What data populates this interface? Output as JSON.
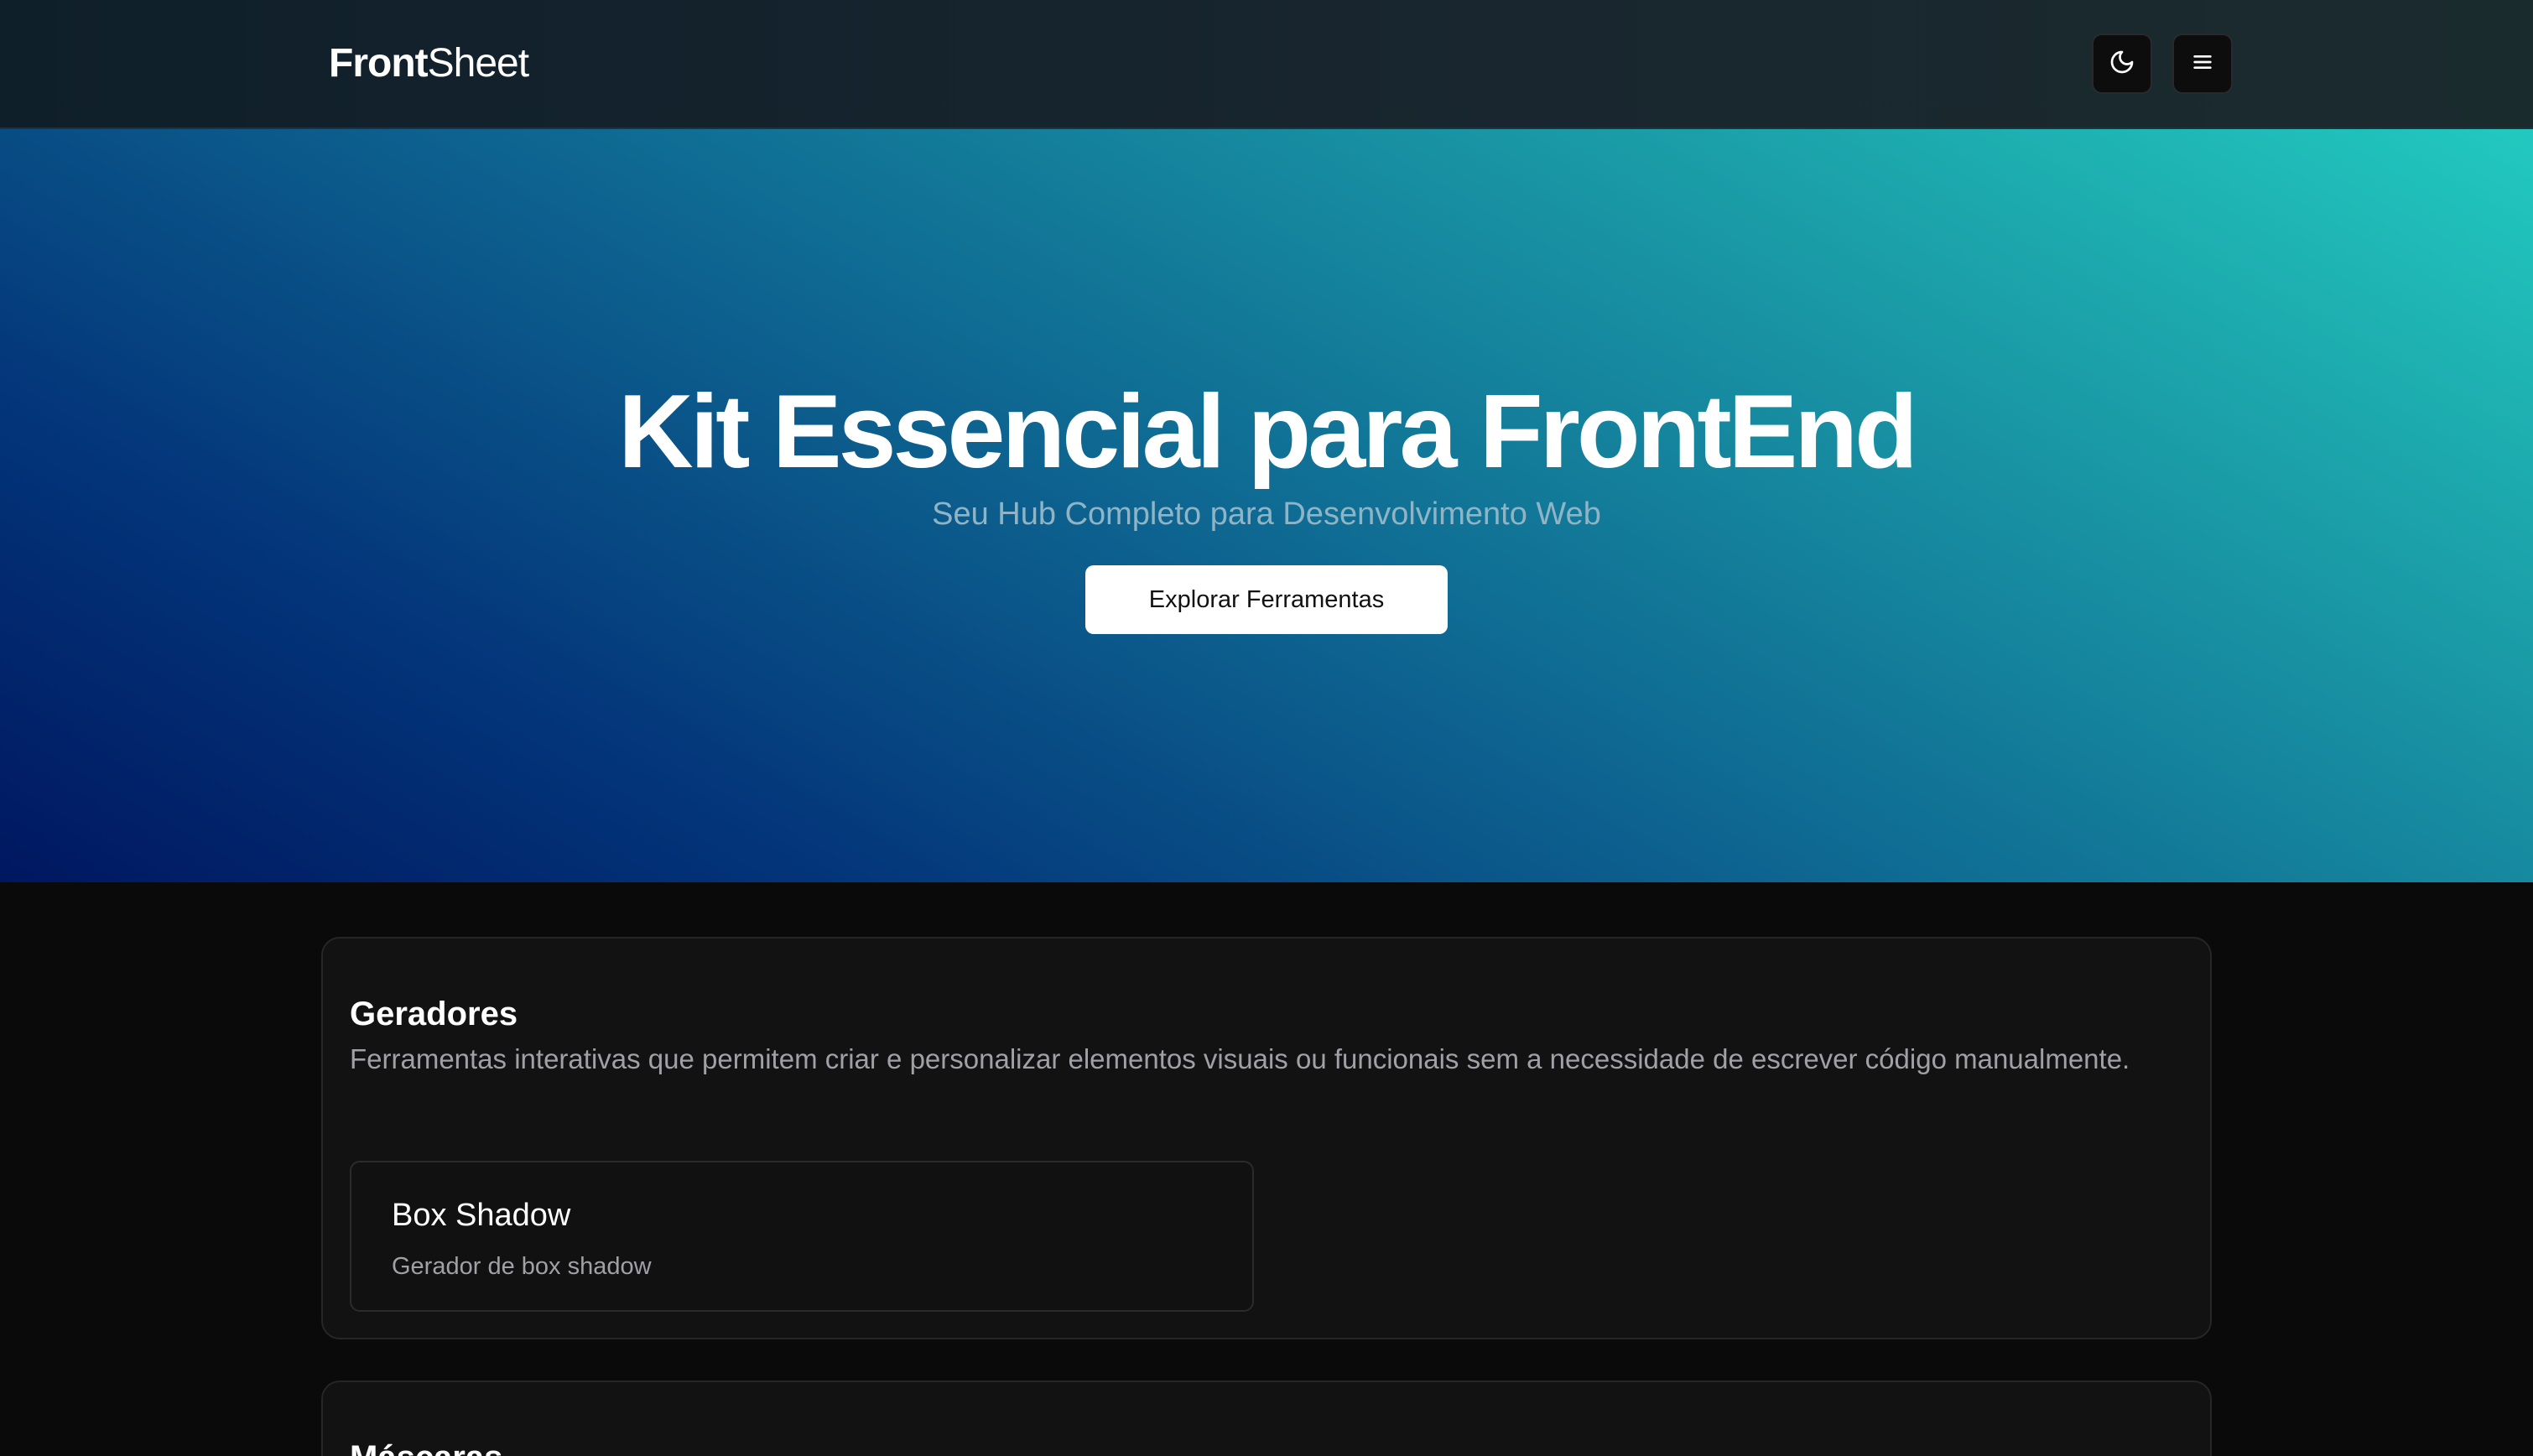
{
  "header": {
    "brand_bold": "Front",
    "brand_light": "Sheet",
    "theme_icon": "moon-icon",
    "menu_icon": "hamburger-menu-icon"
  },
  "hero": {
    "title": "Kit Essencial para FrontEnd",
    "subtitle": "Seu Hub Completo para Desenvolvimento Web",
    "cta_label": "Explorar Ferramentas"
  },
  "sections": [
    {
      "title": "Geradores",
      "description": "Ferramentas interativas que permitem criar e personalizar elementos visuais ou funcionais sem a necessidade de escrever código manualmente.",
      "tools": [
        {
          "title": "Box Shadow",
          "description": "Gerador de box shadow"
        }
      ]
    },
    {
      "title": "Máscaras"
    }
  ],
  "colors": {
    "hero_gradient_start": "#001760",
    "hero_gradient_end": "#22c9bf",
    "page_background": "#0a0a0b",
    "card_background": "#121213"
  }
}
